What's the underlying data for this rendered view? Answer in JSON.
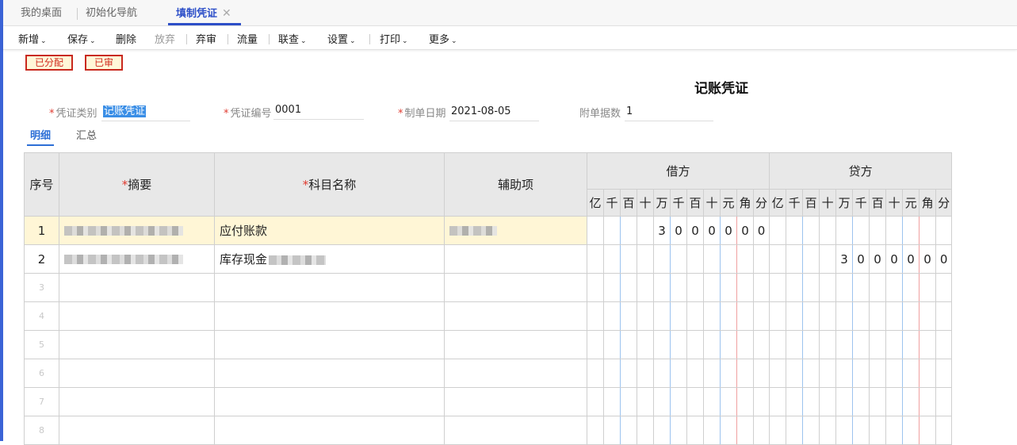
{
  "tabs": [
    {
      "label": "我的桌面"
    },
    {
      "label": "初始化导航"
    },
    {
      "label": "填制凭证",
      "close": "✕"
    }
  ],
  "toolbar": {
    "items": [
      {
        "label": "新增",
        "chev": "⌄"
      },
      {
        "label": "保存",
        "chev": "⌄"
      },
      {
        "label": "删除"
      },
      {
        "label": "放弃"
      },
      {
        "label": "弃审"
      },
      {
        "label": "流量"
      },
      {
        "label": "联查",
        "chev": "⌄"
      },
      {
        "label": "设置",
        "chev": "⌄"
      },
      {
        "label": "打印",
        "chev": "⌄"
      },
      {
        "label": "更多",
        "chev": "⌄"
      }
    ]
  },
  "badges": {
    "allocated": "已分配",
    "audited": "已审"
  },
  "voucher": {
    "title": "记账凭证",
    "type_label": "凭证类别",
    "type_value": "记账凭证",
    "number_label": "凭证编号",
    "number_value": "0001",
    "date_label": "制单日期",
    "date_value": "2021-08-05",
    "attach_label": "附单据数",
    "attach_value": "1"
  },
  "detail_tabs": {
    "detail": "明细",
    "summary": "汇总"
  },
  "grid": {
    "headers": {
      "seq": "序号",
      "summary": "摘要",
      "account": "科目名称",
      "aux": "辅助项",
      "debit": "借方",
      "credit": "贷方",
      "required_mark": "*"
    },
    "digit_units": [
      "亿",
      "千",
      "百",
      "十",
      "万",
      "千",
      "百",
      "十",
      "元",
      "角",
      "分"
    ],
    "rows": [
      {
        "seq": "1",
        "account": "应付账款",
        "debit": [
          "",
          "",
          "",
          "",
          "3",
          "0",
          "0",
          "0",
          "0",
          "0",
          "0"
        ],
        "credit": [
          "",
          "",
          "",
          "",
          "",
          "",
          "",
          "",
          "",
          "",
          ""
        ]
      },
      {
        "seq": "2",
        "account": "库存现金",
        "debit": [
          "",
          "",
          "",
          "",
          "",
          "",
          "",
          "",
          "",
          "",
          ""
        ],
        "credit": [
          "",
          "",
          "",
          "",
          "3",
          "0",
          "0",
          "0",
          "0",
          "0",
          "0"
        ]
      },
      {
        "seq": "3"
      },
      {
        "seq": "4"
      },
      {
        "seq": "5"
      },
      {
        "seq": "6"
      },
      {
        "seq": "7"
      },
      {
        "seq": "8"
      }
    ]
  }
}
